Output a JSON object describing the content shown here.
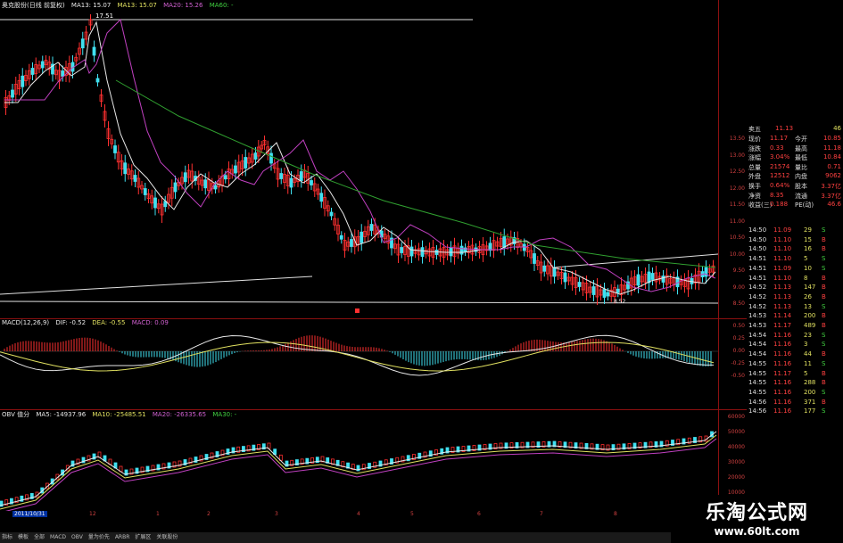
{
  "main_chart": {
    "labels": {
      "title": "奥克股份(日线 前复权)",
      "ma1": "MA13: 15.07",
      "ma2": "MA13: 15.07",
      "ma3": "MA20: 15.26",
      "ma4": "MA60: -",
      "high_mark": "17.51",
      "low_mark": "8.52"
    },
    "y_ticks": [
      "13.50",
      "13.00",
      "12.50",
      "12.00",
      "11.50",
      "11.00",
      "10.50",
      "10.00",
      "9.50",
      "9.00",
      "8.50"
    ],
    "colors": {
      "up": "#ff3030",
      "down": "#40e0f0",
      "ma_white": "#e8e8e8",
      "ma_purple": "#c040c0",
      "ma_green": "#30a030"
    }
  },
  "macd_panel": {
    "labels": {
      "title": "MACD(12,26,9)",
      "dif": "DIF: -0.52",
      "dea": "DEA: -0.55",
      "macd": "MACD: 0.09"
    },
    "y_ticks": [
      "0.50",
      "0.25",
      "0.00",
      "-0.25",
      "-0.50"
    ]
  },
  "volume_panel": {
    "labels": {
      "title": "OBV 值分",
      "ma5": "MA5: -14937.96",
      "ma10": "MA10: -25485.51",
      "ma20": "MA20: -26335.65",
      "ma30": "MA30: -"
    },
    "y_ticks": [
      "60000",
      "50000",
      "40000",
      "30000",
      "20000",
      "10000"
    ]
  },
  "date_axis": {
    "current": "2011/10/31",
    "months": [
      "12",
      "1",
      "2",
      "3",
      "4",
      "5",
      "6",
      "7",
      "8"
    ]
  },
  "quote_panel": {
    "sell5": {
      "label": "卖五",
      "price": "11.13",
      "vol": "46"
    },
    "rows": [
      {
        "l1": "现价",
        "v1": "11.17",
        "l2": "今开",
        "v2": "10.85"
      },
      {
        "l1": "涨跌",
        "v1": "0.33",
        "l2": "最高",
        "v2": "11.18"
      },
      {
        "l1": "涨幅",
        "v1": "3.04%",
        "l2": "最低",
        "v2": "10.84"
      },
      {
        "l1": "总量",
        "v1": "21574",
        "l2": "量比",
        "v2": "0.71"
      },
      {
        "l1": "外盘",
        "v1": "12512",
        "l2": "内盘",
        "v2": "9062"
      },
      {
        "l1": "换手",
        "v1": "0.64%",
        "l2": "股本",
        "v2": "3.37亿"
      },
      {
        "l1": "净资",
        "v1": "8.35",
        "l2": "流通",
        "v2": "3.37亿"
      },
      {
        "l1": "收益(三)",
        "v1": "0.188",
        "l2": "PE(动)",
        "v2": "46.6"
      }
    ],
    "ticks": [
      {
        "t": "14:50",
        "p": "11.09",
        "v": "29",
        "d": "S"
      },
      {
        "t": "14:50",
        "p": "11.10",
        "v": "15",
        "d": "B"
      },
      {
        "t": "14:50",
        "p": "11.10",
        "v": "16",
        "d": "B"
      },
      {
        "t": "14:51",
        "p": "11.10",
        "v": "5",
        "d": "S"
      },
      {
        "t": "14:51",
        "p": "11.09",
        "v": "10",
        "d": "S"
      },
      {
        "t": "14:51",
        "p": "11.10",
        "v": "8",
        "d": "B"
      },
      {
        "t": "14:52",
        "p": "11.13",
        "v": "147",
        "d": "B"
      },
      {
        "t": "14:52",
        "p": "11.13",
        "v": "26",
        "d": "B"
      },
      {
        "t": "14:52",
        "p": "11.13",
        "v": "13",
        "d": "S"
      },
      {
        "t": "14:53",
        "p": "11.14",
        "v": "200",
        "d": "B"
      },
      {
        "t": "14:53",
        "p": "11.17",
        "v": "489",
        "d": "B"
      },
      {
        "t": "14:54",
        "p": "11.16",
        "v": "23",
        "d": "S"
      },
      {
        "t": "14:54",
        "p": "11.16",
        "v": "3",
        "d": "S"
      },
      {
        "t": "14:54",
        "p": "11.16",
        "v": "44",
        "d": "B"
      },
      {
        "t": "14:55",
        "p": "11.16",
        "v": "11",
        "d": "S"
      },
      {
        "t": "14:55",
        "p": "11.17",
        "v": "5",
        "d": "B"
      },
      {
        "t": "14:55",
        "p": "11.16",
        "v": "288",
        "d": "B"
      },
      {
        "t": "14:55",
        "p": "11.16",
        "v": "200",
        "d": "S"
      },
      {
        "t": "14:56",
        "p": "11.16",
        "v": "371",
        "d": "B"
      },
      {
        "t": "14:56",
        "p": "11.16",
        "v": "177",
        "d": "S"
      }
    ]
  },
  "bottom_bar": [
    "指标",
    "模板",
    "全部",
    "MACD",
    "OBV",
    "量为价先",
    "ARBR",
    "扩展区",
    "关联股份"
  ],
  "watermark": {
    "title": "乐淘公式网",
    "url": "www.60lt.com"
  }
}
